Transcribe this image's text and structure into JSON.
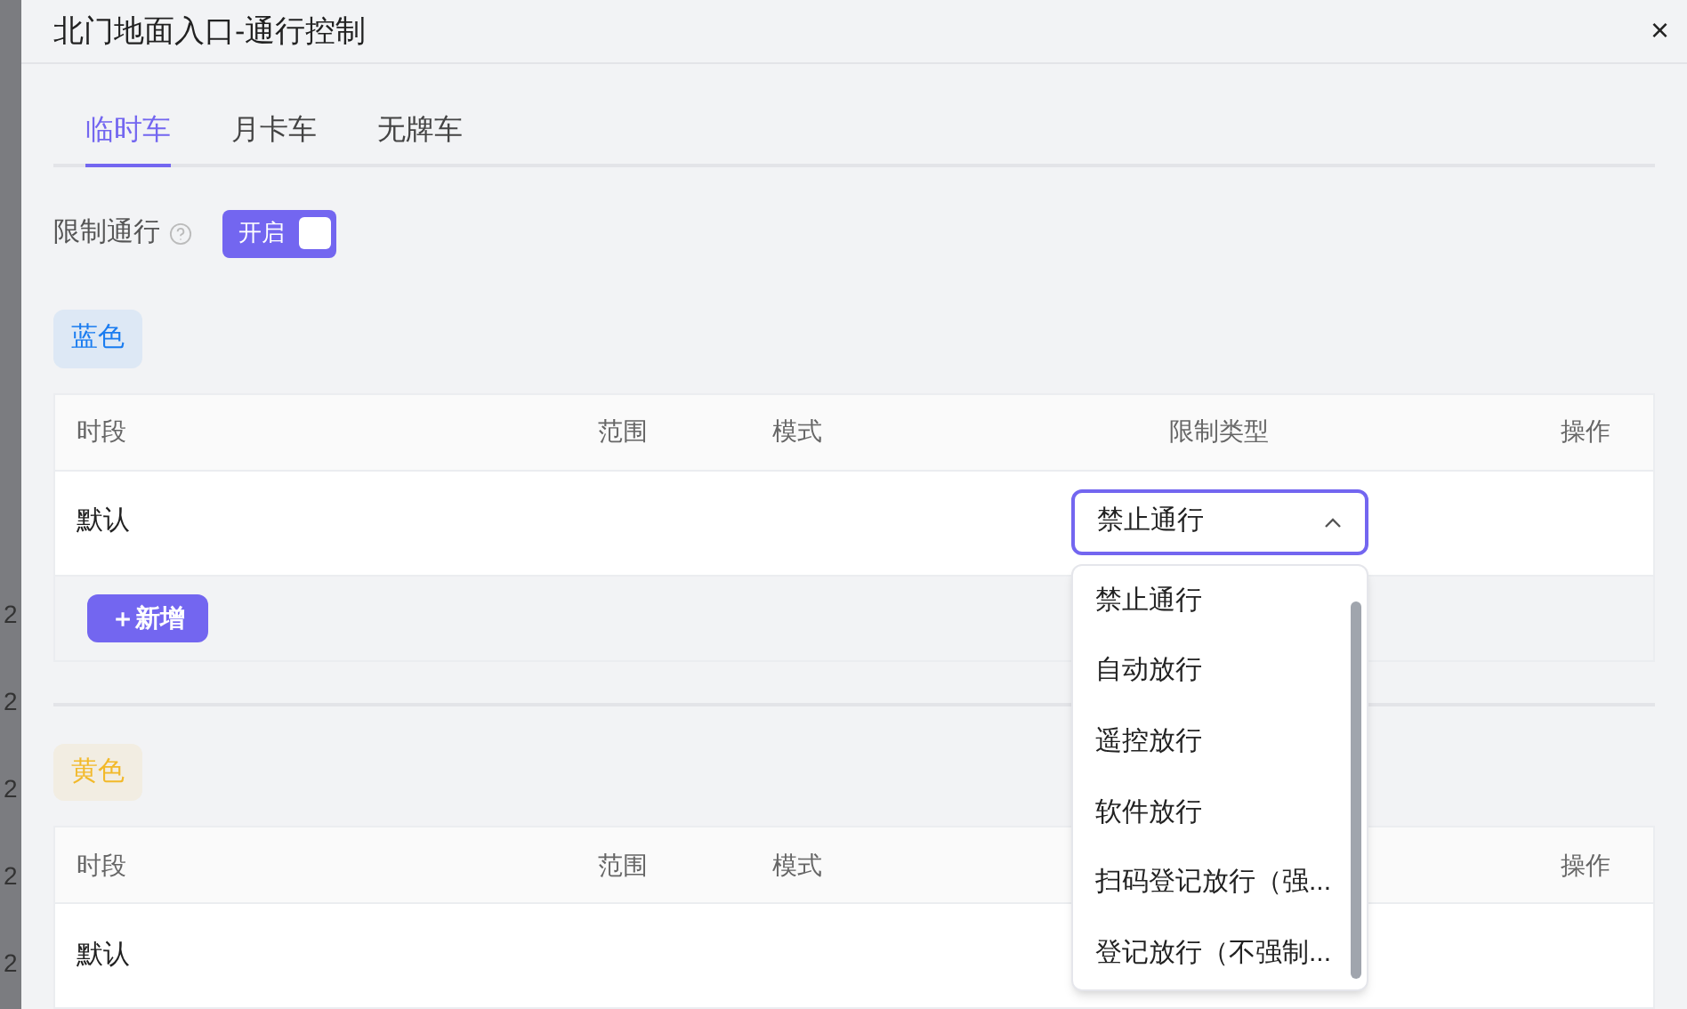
{
  "background": {
    "fragments": [
      "2",
      "2",
      "2",
      "2",
      "2"
    ]
  },
  "dialog": {
    "title": "北门地面入口-通行控制",
    "close": "×"
  },
  "tabs": [
    {
      "label": "临时车",
      "selected": true
    },
    {
      "label": "月卡车",
      "selected": false
    },
    {
      "label": "无牌车",
      "selected": false
    }
  ],
  "restriction": {
    "label": "限制通行",
    "switch": {
      "label": "开启",
      "on": true
    }
  },
  "groups": [
    {
      "tag": "蓝色",
      "color": "#1a7cf0",
      "columns": [
        {
          "kind": "period",
          "label": "时段"
        },
        {
          "kind": "range",
          "label": "范围"
        },
        {
          "kind": "mode",
          "label": "模式"
        },
        {
          "kind": "type",
          "label": "限制类型"
        },
        {
          "kind": "action",
          "label": "操作"
        }
      ],
      "rows": [
        {
          "period": "默认",
          "type": {
            "value": "禁止通行",
            "expanded": true
          }
        }
      ],
      "add_button": "＋新增"
    },
    {
      "tag": "黄色",
      "color": "#f2b92a",
      "columns": [
        {
          "kind": "period",
          "label": "时段"
        },
        {
          "kind": "range",
          "label": "范围"
        },
        {
          "kind": "mode",
          "label": "模式"
        },
        {
          "kind": "action",
          "label": "操作"
        }
      ],
      "rows": [
        {
          "period": "默认"
        }
      ]
    }
  ],
  "dropdown": {
    "options": [
      "禁止通行",
      "自动放行",
      "遥控放行",
      "软件放行",
      "扫码登记放行（强...",
      "登记放行（不强制..."
    ]
  }
}
